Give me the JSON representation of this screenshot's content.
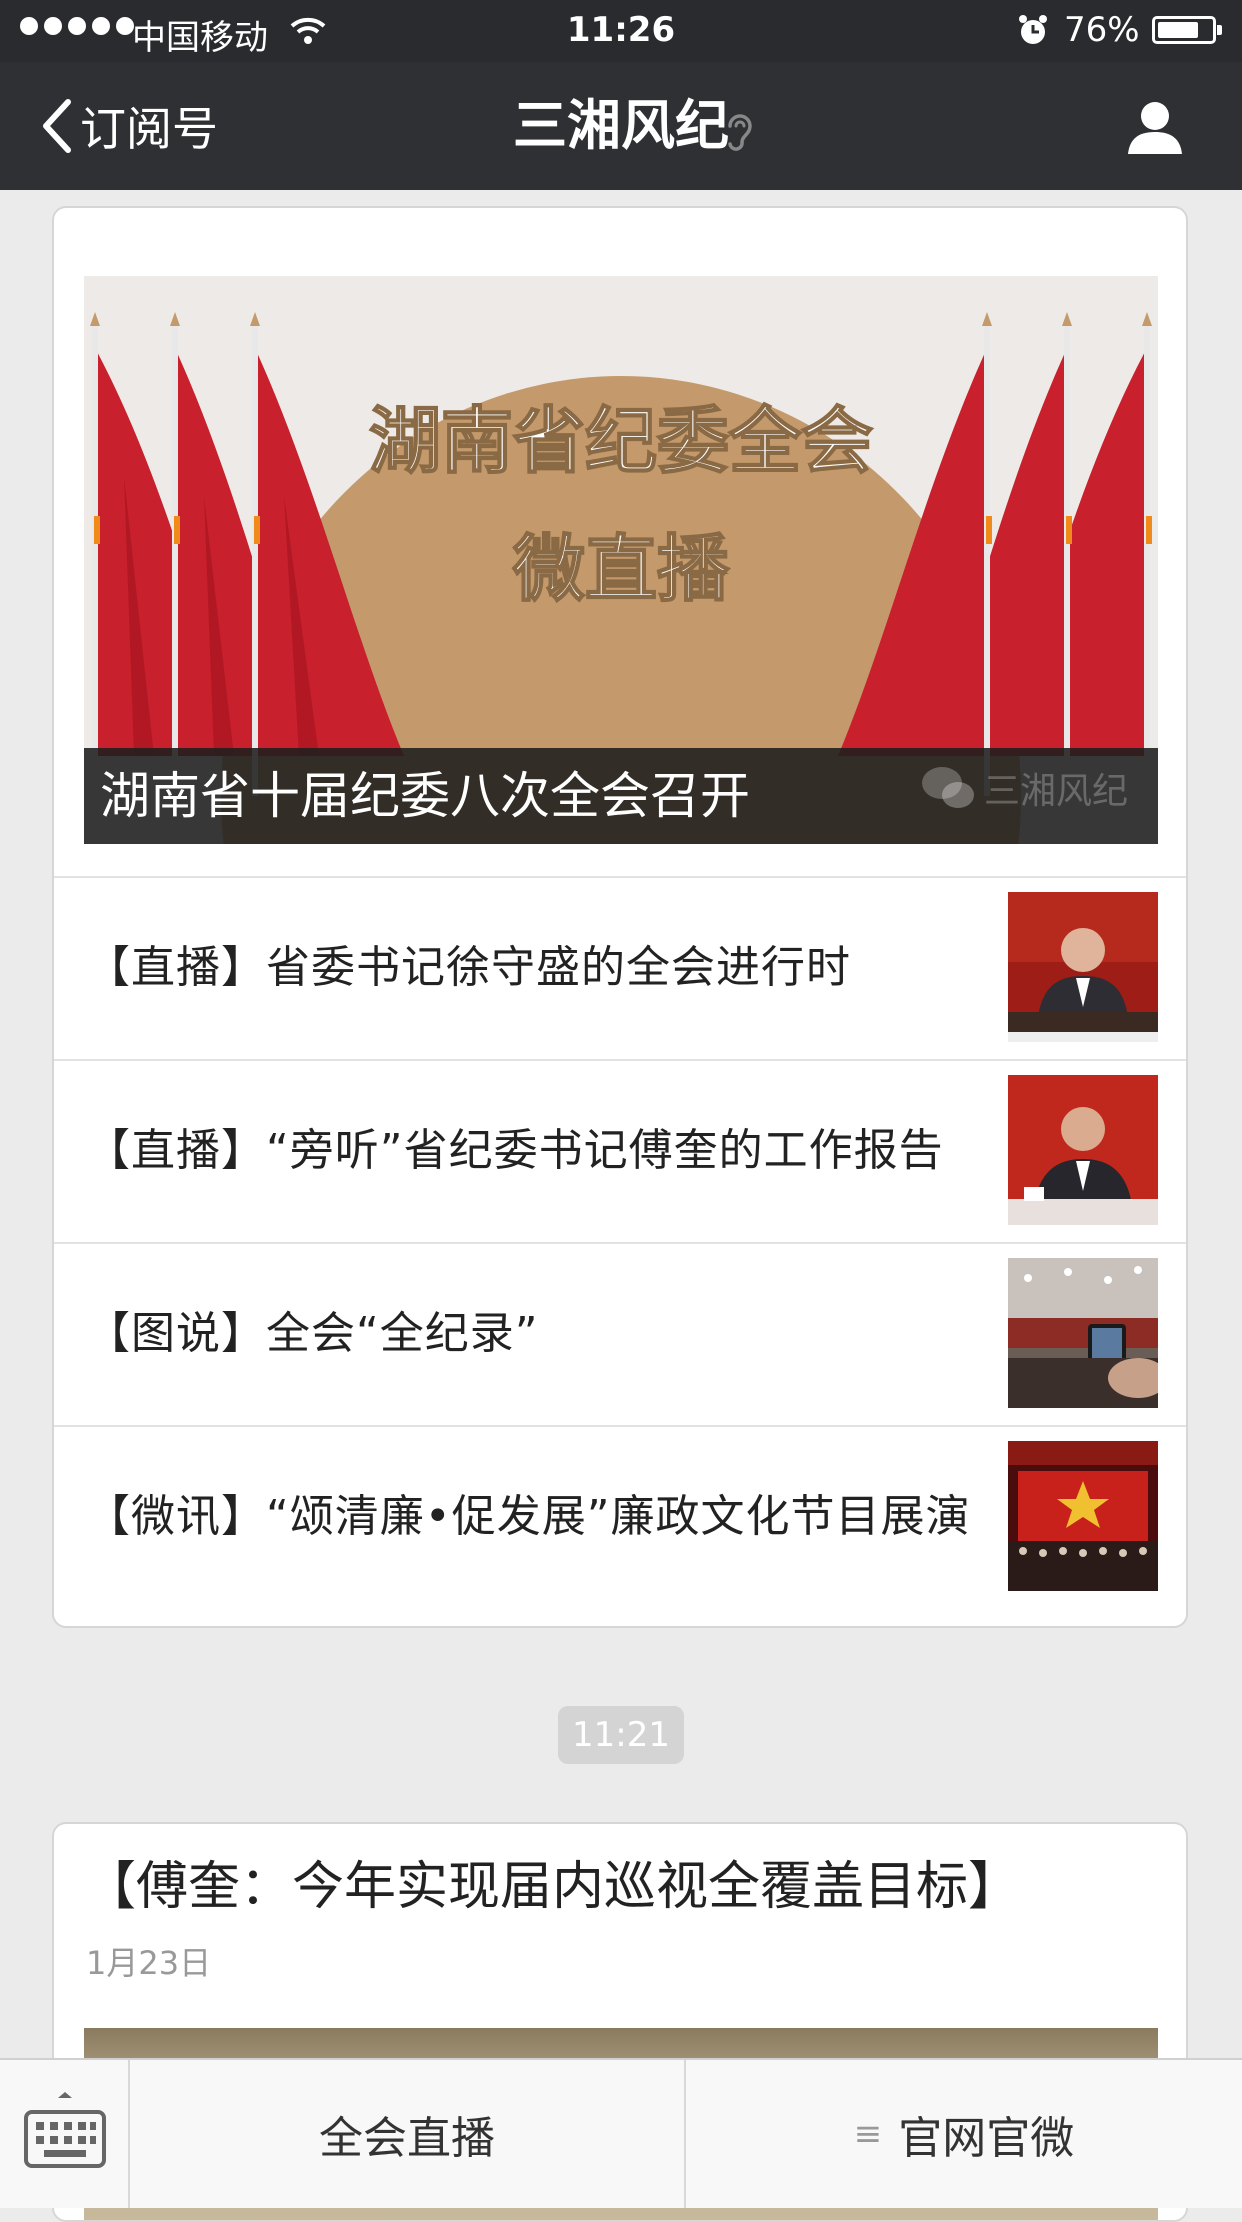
{
  "status_bar": {
    "carrier": "中国移动",
    "time": "11:26",
    "battery": "76%",
    "battery_level": 0.76
  },
  "nav": {
    "back_label": "订阅号",
    "title": "三湘风纪"
  },
  "card1": {
    "cover_text_line1": "湖南省纪委全会",
    "cover_text_line2": "微直播",
    "headline": "湖南省十届纪委八次全会召开",
    "watermark": "三湘风纪",
    "items": [
      {
        "text": "【直播】省委书记徐守盛的全会进行时"
      },
      {
        "text": "【直播】“旁听”省纪委书记傅奎的工作报告"
      },
      {
        "text": "【图说】全会“全纪录”"
      },
      {
        "text": "【微讯】“颂清廉•促发展”廉政文化节目展演"
      }
    ]
  },
  "timestamp": "11:21",
  "card2": {
    "title": "【傅奎：今年实现届内巡视全覆盖目标】",
    "date": "1月23日"
  },
  "menu": {
    "button1": "全会直播",
    "button2": "官网官微",
    "button2_icon": "≡"
  },
  "colors": {
    "nav_bg": "#2f3033",
    "status_bg": "#2a2b2e",
    "page_bg": "#ebebeb",
    "flag_red": "#c8202c"
  }
}
